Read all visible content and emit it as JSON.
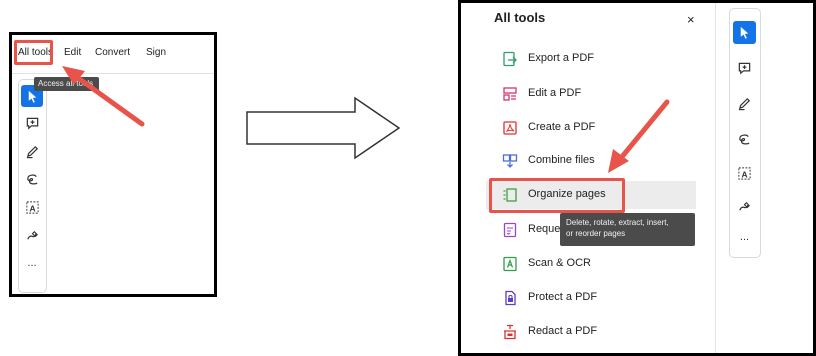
{
  "left_panel": {
    "menu": {
      "all_tools": "All tools",
      "edit": "Edit",
      "convert": "Convert",
      "sign": "Sign"
    },
    "tooltip": "Access all tools",
    "toolbar_more": "..."
  },
  "right_panel": {
    "title": "All tools",
    "close_label": "×",
    "tools": [
      {
        "label": "Export a PDF",
        "icon": "export-pdf-icon",
        "color": "#2f9e6a"
      },
      {
        "label": "Edit a PDF",
        "icon": "edit-pdf-icon",
        "color": "#d6336c"
      },
      {
        "label": "Create a PDF",
        "icon": "create-pdf-icon",
        "color": "#e03131"
      },
      {
        "label": "Combine files",
        "icon": "combine-files-icon",
        "color": "#4b6fd6"
      },
      {
        "label": "Organize pages",
        "icon": "organize-pages-icon",
        "color": "#40a040"
      },
      {
        "label": "Reque",
        "icon": "request-esign-icon",
        "color": "#9b45c9"
      },
      {
        "label": "Scan & OCR",
        "icon": "scan-ocr-icon",
        "color": "#2f9e44"
      },
      {
        "label": "Protect a PDF",
        "icon": "protect-pdf-icon",
        "color": "#5f3dc4"
      },
      {
        "label": "Redact a PDF",
        "icon": "redact-pdf-icon",
        "color": "#e03131"
      }
    ],
    "tooltip_line1": "Delete, rotate, extract, insert,",
    "tooltip_line2": "or reorder pages",
    "toolbar_more": "..."
  },
  "colors": {
    "highlight": "#e8534a",
    "active_tool": "#1473e6",
    "tooltip_bg": "#4b4b4b"
  }
}
